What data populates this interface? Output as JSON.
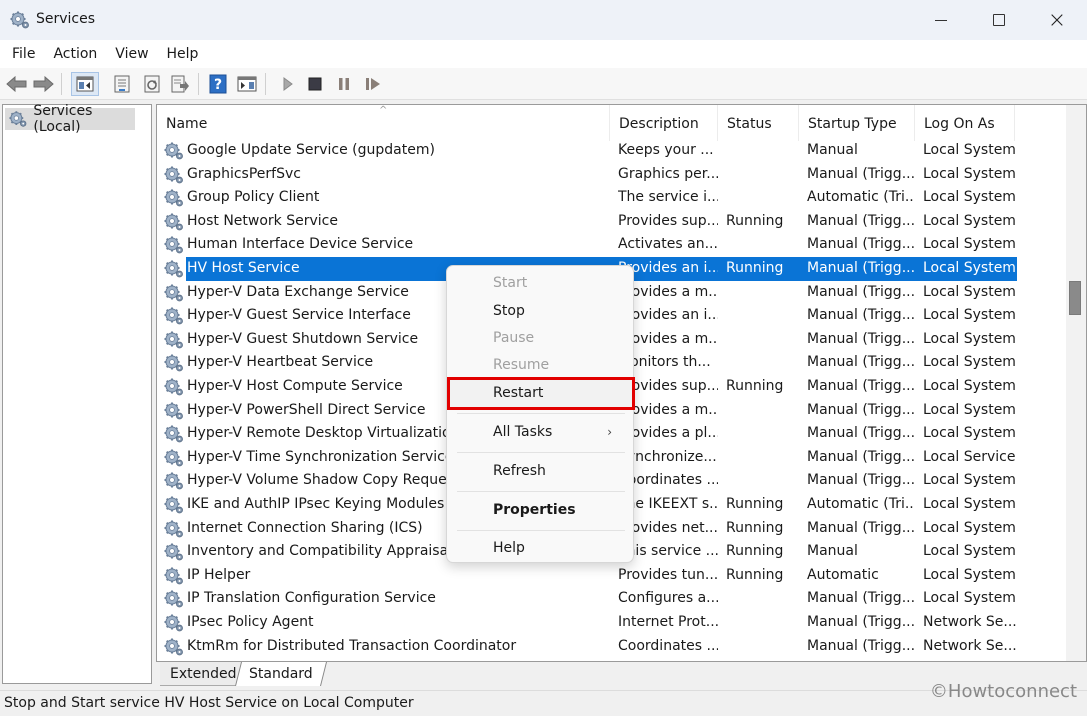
{
  "window": {
    "title": "Services",
    "app_icon": "gears-icon",
    "controls": {
      "minimize": "minimize-icon",
      "maximize": "maximize-icon",
      "close": "×"
    }
  },
  "menubar": {
    "items": [
      "File",
      "Action",
      "View",
      "Help"
    ]
  },
  "toolbar": {
    "buttons": [
      {
        "name": "back-icon",
        "glyph": "⇦"
      },
      {
        "name": "forward-icon",
        "glyph": "⇨"
      },
      {
        "name": "show-hide-console-tree-icon",
        "glyph": "▤"
      },
      {
        "name": "properties-icon",
        "glyph": "▦"
      },
      {
        "name": "refresh-icon",
        "glyph": "↻"
      },
      {
        "name": "export-list-icon",
        "glyph": "⇲"
      },
      {
        "name": "help-icon",
        "glyph": "?"
      },
      {
        "name": "show-hide-action-pane-icon",
        "glyph": "▥"
      },
      {
        "name": "start-service-icon",
        "glyph": "▶"
      },
      {
        "name": "stop-service-icon",
        "glyph": "■"
      },
      {
        "name": "pause-service-icon",
        "glyph": "❚❚"
      },
      {
        "name": "restart-service-icon",
        "glyph": "❚▶"
      }
    ]
  },
  "tree": {
    "root_label": "Services (Local)"
  },
  "list": {
    "sort_indicator": "^",
    "columns": [
      "Name",
      "Description",
      "Status",
      "Startup Type",
      "Log On As"
    ],
    "selected_index": 5,
    "rows": [
      {
        "name": "Google Update Service (gupdatem)",
        "description": "Keeps your ...",
        "status": "",
        "startup": "Manual",
        "logon": "Local System"
      },
      {
        "name": "GraphicsPerfSvc",
        "description": "Graphics per...",
        "status": "",
        "startup": "Manual (Trigg...",
        "logon": "Local System"
      },
      {
        "name": "Group Policy Client",
        "description": "The service i...",
        "status": "",
        "startup": "Automatic (Tri...",
        "logon": "Local System"
      },
      {
        "name": "Host Network Service",
        "description": "Provides sup...",
        "status": "Running",
        "startup": "Manual (Trigg...",
        "logon": "Local System"
      },
      {
        "name": "Human Interface Device Service",
        "description": "Activates an...",
        "status": "",
        "startup": "Manual (Trigg...",
        "logon": "Local System"
      },
      {
        "name": "HV Host Service",
        "description": "Provides an i...",
        "status": "Running",
        "startup": "Manual (Trigg...",
        "logon": "Local System"
      },
      {
        "name": "Hyper-V Data Exchange Service",
        "description": "Provides a m...",
        "status": "",
        "startup": "Manual (Trigg...",
        "logon": "Local System"
      },
      {
        "name": "Hyper-V Guest Service Interface",
        "description": "Provides an i...",
        "status": "",
        "startup": "Manual (Trigg...",
        "logon": "Local System"
      },
      {
        "name": "Hyper-V Guest Shutdown Service",
        "description": "Provides a m...",
        "status": "",
        "startup": "Manual (Trigg...",
        "logon": "Local System"
      },
      {
        "name": "Hyper-V Heartbeat Service",
        "description": "Monitors th...",
        "status": "",
        "startup": "Manual (Trigg...",
        "logon": "Local System"
      },
      {
        "name": "Hyper-V Host Compute Service",
        "description": "Provides sup...",
        "status": "Running",
        "startup": "Manual (Trigg...",
        "logon": "Local System"
      },
      {
        "name": "Hyper-V PowerShell Direct Service",
        "description": "Provides a m...",
        "status": "",
        "startup": "Manual (Trigg...",
        "logon": "Local System"
      },
      {
        "name": "Hyper-V Remote Desktop Virtualization Service",
        "description": "Provides a pl...",
        "status": "",
        "startup": "Manual (Trigg...",
        "logon": "Local System"
      },
      {
        "name": "Hyper-V Time Synchronization Service",
        "description": "Synchronize...",
        "status": "",
        "startup": "Manual (Trigg...",
        "logon": "Local Service"
      },
      {
        "name": "Hyper-V Volume Shadow Copy Requestor",
        "description": "Coordinates ...",
        "status": "",
        "startup": "Manual (Trigg...",
        "logon": "Local System"
      },
      {
        "name": "IKE and AuthIP IPsec Keying Modules",
        "description": "The IKEEXT s...",
        "status": "Running",
        "startup": "Automatic (Tri...",
        "logon": "Local System"
      },
      {
        "name": "Internet Connection Sharing (ICS)",
        "description": "Provides net...",
        "status": "Running",
        "startup": "Manual (Trigg...",
        "logon": "Local System"
      },
      {
        "name": "Inventory and Compatibility Appraisal service",
        "description": "This service ...",
        "status": "Running",
        "startup": "Manual",
        "logon": "Local System"
      },
      {
        "name": "IP Helper",
        "description": "Provides tun...",
        "status": "Running",
        "startup": "Automatic",
        "logon": "Local System"
      },
      {
        "name": "IP Translation Configuration Service",
        "description": "Configures a...",
        "status": "",
        "startup": "Manual (Trigg...",
        "logon": "Local System"
      },
      {
        "name": "IPsec Policy Agent",
        "description": "Internet Prot...",
        "status": "",
        "startup": "Manual (Trigg...",
        "logon": "Network Se..."
      },
      {
        "name": "KtmRm for Distributed Transaction Coordinator",
        "description": "Coordinates ...",
        "status": "",
        "startup": "Manual (Trigg...",
        "logon": "Network Se..."
      }
    ]
  },
  "tabs": {
    "extended": "Extended",
    "standard": "Standard",
    "active": "Standard"
  },
  "statusbar": {
    "text": "Stop and Start service HV Host Service on Local Computer"
  },
  "watermark": "©Howtoconnect",
  "context_menu": {
    "items": [
      {
        "label": "Start",
        "disabled": true
      },
      {
        "label": "Stop",
        "disabled": false
      },
      {
        "label": "Pause",
        "disabled": true
      },
      {
        "label": "Resume",
        "disabled": true
      },
      {
        "label": "Restart",
        "disabled": false,
        "highlighted": true
      },
      {
        "label": "All Tasks",
        "disabled": false,
        "submenu": "›"
      },
      {
        "label": "Refresh",
        "disabled": false
      },
      {
        "label": "Properties",
        "disabled": false,
        "bold": true
      },
      {
        "label": "Help",
        "disabled": false
      }
    ],
    "highlight_color": "#e20000"
  },
  "colors": {
    "selection": "#0a74d6",
    "titlebar": "#eef2f8"
  }
}
